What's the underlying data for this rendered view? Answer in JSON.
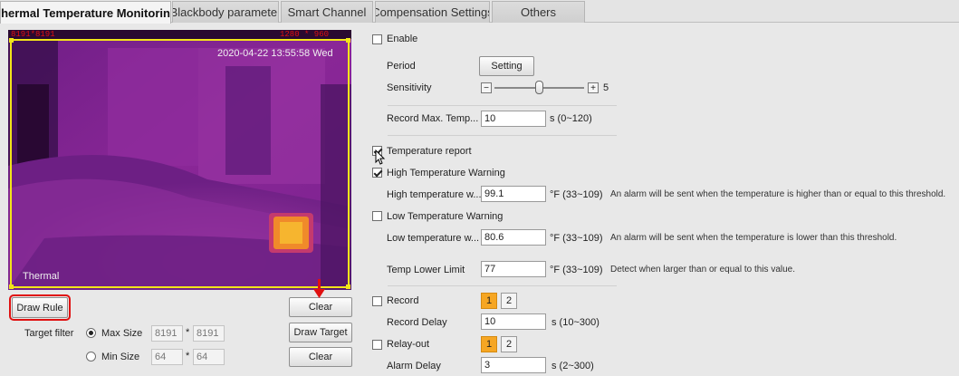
{
  "tabs": [
    {
      "label": "Thermal Temperature Monitoring"
    },
    {
      "label": "Blackbody parameter"
    },
    {
      "label": "Smart Channel"
    },
    {
      "label": "Compensation Settings"
    },
    {
      "label": "Others"
    }
  ],
  "video": {
    "timestamp": "2020-04-22 13:55:58 Wed",
    "channel_label": "Thermal",
    "corner_left": "8191*8191",
    "corner_right": "1280 * 960"
  },
  "left": {
    "draw_rule": "Draw Rule",
    "clear_top": "Clear",
    "target_filter": "Target filter",
    "max_size": "Max Size",
    "min_size": "Min Size",
    "max_w": "8191",
    "max_h": "8191",
    "min_w": "64",
    "min_h": "64",
    "times": "*",
    "draw_target": "Draw Target",
    "clear_bottom": "Clear"
  },
  "right": {
    "enable": "Enable",
    "period": "Period",
    "setting": "Setting",
    "sensitivity": "Sensitivity",
    "sensitivity_value": "5",
    "sensitivity_level": 0.5,
    "minus": "−",
    "plus": "+",
    "record_max_temp": "Record Max. Temp...",
    "record_max_temp_value": "10",
    "record_max_temp_range": "s (0~120)",
    "temperature_report": "Temperature report",
    "high_warning": "High Temperature Warning",
    "high_temp": "High temperature w...",
    "high_temp_value": "99.1",
    "high_temp_range": "°F (33~109)",
    "high_hint": "An alarm will be sent when the temperature is higher than or equal to this threshold.",
    "low_warning": "Low Temperature Warning",
    "low_temp": "Low temperature w...",
    "low_temp_value": "80.6",
    "low_temp_range": "°F (33~109)",
    "low_hint": "An alarm will be sent when the temperature is lower than this threshold.",
    "temp_lower_limit": "Temp Lower Limit",
    "temp_lower_value": "77",
    "temp_lower_range": "°F (33~109)",
    "temp_lower_hint": "Detect when larger than or equal to this value.",
    "record": "Record",
    "record_delay": "Record Delay",
    "record_delay_value": "10",
    "record_delay_range": "s (10~300)",
    "relay_out": "Relay-out",
    "alarm_delay": "Alarm Delay",
    "alarm_delay_value": "3",
    "alarm_delay_range": "s (2~300)",
    "one": "1",
    "two": "2"
  },
  "colors": {
    "accent": "#f6a623",
    "highlight_red": "#e01010",
    "thermal_purple": "#9a2aa0",
    "roi_yellow": "#f2e51a"
  }
}
